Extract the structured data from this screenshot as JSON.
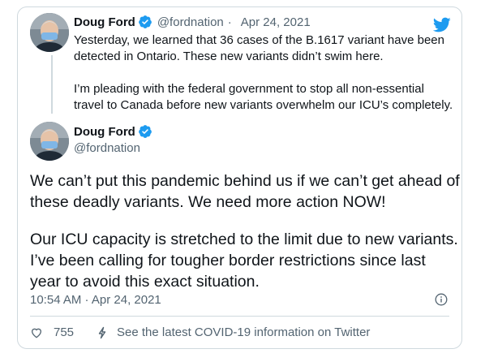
{
  "colors": {
    "accent": "#1d9bf0",
    "text": "#0f1419",
    "muted": "#536471",
    "border": "#cfd9de"
  },
  "quoted": {
    "name": "Doug Ford",
    "handle": "@fordnation",
    "sep": "·",
    "date": "Apr 24, 2021",
    "paragraph1": "Yesterday, we learned that 36 cases of the B.1617 variant have been detected in Ontario. These new variants didn’t swim here.",
    "paragraph2": "I’m pleading with the federal government to stop all non-essential travel to Canada before new variants overwhelm our ICU’s completely."
  },
  "main": {
    "name": "Doug Ford",
    "handle": "@fordnation",
    "paragraph1": "We can’t put this pandemic behind us if we can’t get ahead of these deadly variants. We need more action NOW!",
    "paragraph2": "Our ICU capacity is stretched to the limit due to new variants. I’ve been calling for tougher border restrictions since last year to avoid this exact situation.",
    "timestamp": "10:54 AM · Apr 24, 2021"
  },
  "actions": {
    "likes": "755",
    "covid_link": "See the latest COVID-19 information on Twitter"
  },
  "icons": [
    "verified-icon",
    "twitter-bird-icon",
    "info-icon",
    "heart-icon",
    "lightning-icon"
  ]
}
